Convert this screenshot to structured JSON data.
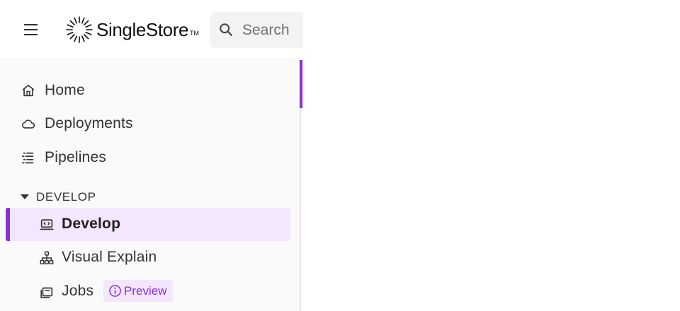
{
  "header": {
    "brand": "SingleStore",
    "brand_tm": "TM",
    "search_placeholder": "Search"
  },
  "sidebar": {
    "items": [
      {
        "label": "Home",
        "icon": "home-icon"
      },
      {
        "label": "Deployments",
        "icon": "cloud-icon"
      },
      {
        "label": "Pipelines",
        "icon": "pipelines-icon"
      }
    ],
    "section": {
      "label": "DEVELOP",
      "expanded": true,
      "items": [
        {
          "label": "Develop",
          "icon": "develop-icon",
          "active": true
        },
        {
          "label": "Visual Explain",
          "icon": "hierarchy-icon"
        },
        {
          "label": "Jobs",
          "icon": "jobs-icon",
          "badge": "Preview"
        }
      ]
    }
  },
  "colors": {
    "accent": "#8a2fd9",
    "accent_bg": "#f3e6fd",
    "sidebar_bg": "#fafafa"
  }
}
